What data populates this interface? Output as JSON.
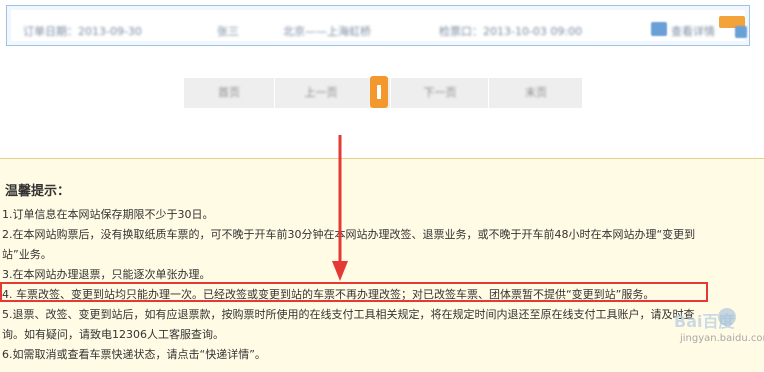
{
  "order_row": {
    "fields": [
      "订单日期：2013-09-30",
      "张三",
      "北京——上海虹桥",
      "检票口：2013-10-03 09:00",
      "查看详情"
    ],
    "badge_icon": "orange-tag-icon",
    "end_icon": "blue-square-icon"
  },
  "pagination": {
    "first": "首页",
    "prev": "上一页",
    "current": "1",
    "next": "下一页",
    "last": "末页",
    "current_color": "#f3982c"
  },
  "tips": {
    "title": "温馨提示：",
    "lines": [
      "1.订单信息在本网站保存期限不少于30日。",
      "2.在本网站购票后，没有换取纸质车票的，可不晚于开车前30分钟在本网站办理改签、退票业务，或不晚于开车前48小时在本网站办理“变更到",
      "站”业务。",
      "3.在本网站办理退票，只能逐次单张办理。",
      "4. 车票改签、变更到站均只能办理一次。已经改签或变更到站的车票不再办理改签；对已改签车票、团体票暂不提供“变更到站”服务。",
      "5.退票、改签、变更到站后，如有应退票款，按购票时所使用的在线支付工具相关规定，将在规定时间内退还至原在线支付工具账户，请及时查",
      "询。如有疑问，请致电12306人工客服查询。",
      "6.如需取消或查看车票快递状态，请点击“快递详情”。"
    ],
    "background": "#fffbe5"
  },
  "annotation": {
    "highlight_color": "#e53935",
    "arrow_color": "#e53935"
  },
  "watermark": {
    "logo_text": "Bai百度",
    "site": "jingyan.baidu.com"
  }
}
